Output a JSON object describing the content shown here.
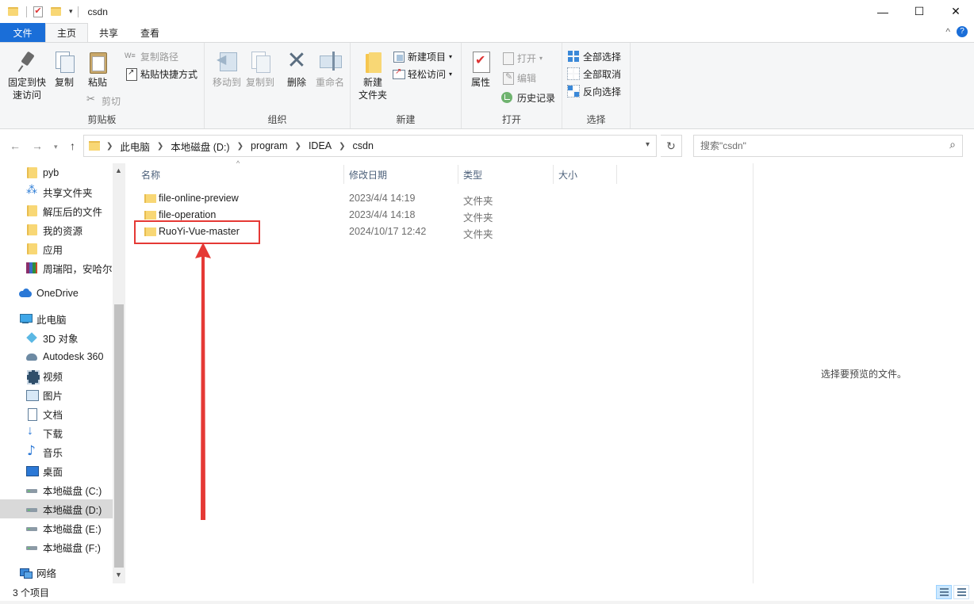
{
  "window": {
    "title": "csdn",
    "qa_dropdown": "▾",
    "controls": {
      "minimize": "—",
      "maximize": "☐",
      "close": "✕"
    }
  },
  "ribbon_tabs": [
    "文件",
    "主页",
    "共享",
    "查看"
  ],
  "ribbon_right": {
    "collapse": "^",
    "help": "?"
  },
  "ribbon": {
    "clipboard": {
      "label": "剪贴板",
      "pin": "固定到快\n速访问",
      "copy": "复制",
      "paste": "粘贴",
      "copy_path": "复制路径",
      "paste_shortcut": "粘贴快捷方式",
      "cut": "剪切"
    },
    "organize": {
      "label": "组织",
      "move_to": "移动到",
      "copy_to": "复制到",
      "delete": "删除",
      "rename": "重命名"
    },
    "new": {
      "label": "新建",
      "new_folder": "新建\n文件夹",
      "new_item": "新建项目",
      "easy_access": "轻松访问"
    },
    "open": {
      "label": "打开",
      "properties": "属性",
      "open": "打开",
      "edit": "编辑",
      "history": "历史记录"
    },
    "select": {
      "label": "选择",
      "select_all": "全部选择",
      "select_none": "全部取消",
      "invert": "反向选择"
    }
  },
  "address": {
    "breadcrumbs": [
      "此电脑",
      "本地磁盘 (D:)",
      "program",
      "IDEA",
      "csdn"
    ],
    "search_placeholder": "搜索\"csdn\""
  },
  "nav": [
    {
      "label": "pyb",
      "icon": "folder"
    },
    {
      "label": "共享文件夹",
      "icon": "share"
    },
    {
      "label": "解压后的文件",
      "icon": "folder"
    },
    {
      "label": "我的资源",
      "icon": "folder"
    },
    {
      "label": "应用",
      "icon": "folder"
    },
    {
      "label": "周瑞阳，安哈尔",
      "icon": "rar"
    },
    {
      "label": "OneDrive",
      "icon": "cloud"
    },
    {
      "label": "此电脑",
      "icon": "pc"
    },
    {
      "label": "3D 对象",
      "icon": "3d"
    },
    {
      "label": "Autodesk 360",
      "icon": "autodesk"
    },
    {
      "label": "视频",
      "icon": "video"
    },
    {
      "label": "图片",
      "icon": "picture"
    },
    {
      "label": "文档",
      "icon": "document"
    },
    {
      "label": "下载",
      "icon": "download"
    },
    {
      "label": "音乐",
      "icon": "music"
    },
    {
      "label": "桌面",
      "icon": "desktop"
    },
    {
      "label": "本地磁盘 (C:)",
      "icon": "drive"
    },
    {
      "label": "本地磁盘 (D:)",
      "icon": "drive",
      "selected": true
    },
    {
      "label": "本地磁盘 (E:)",
      "icon": "drive"
    },
    {
      "label": "本地磁盘 (F:)",
      "icon": "drive"
    },
    {
      "label": "网络",
      "icon": "network"
    }
  ],
  "columns": {
    "name": "名称",
    "date": "修改日期",
    "type": "类型",
    "size": "大小"
  },
  "files": [
    {
      "name": "file-online-preview",
      "date": "2023/4/4 14:19",
      "type": "文件夹"
    },
    {
      "name": "file-operation",
      "date": "2023/4/4 14:18",
      "type": "文件夹"
    },
    {
      "name": "RuoYi-Vue-master",
      "date": "2024/10/17 12:42",
      "type": "文件夹"
    }
  ],
  "preview_text": "选择要预览的文件。",
  "status": {
    "count": "3 个项目"
  },
  "colors": {
    "accent": "#1a6ed8",
    "annotation": "#e53935",
    "folder": "#f8d775"
  }
}
